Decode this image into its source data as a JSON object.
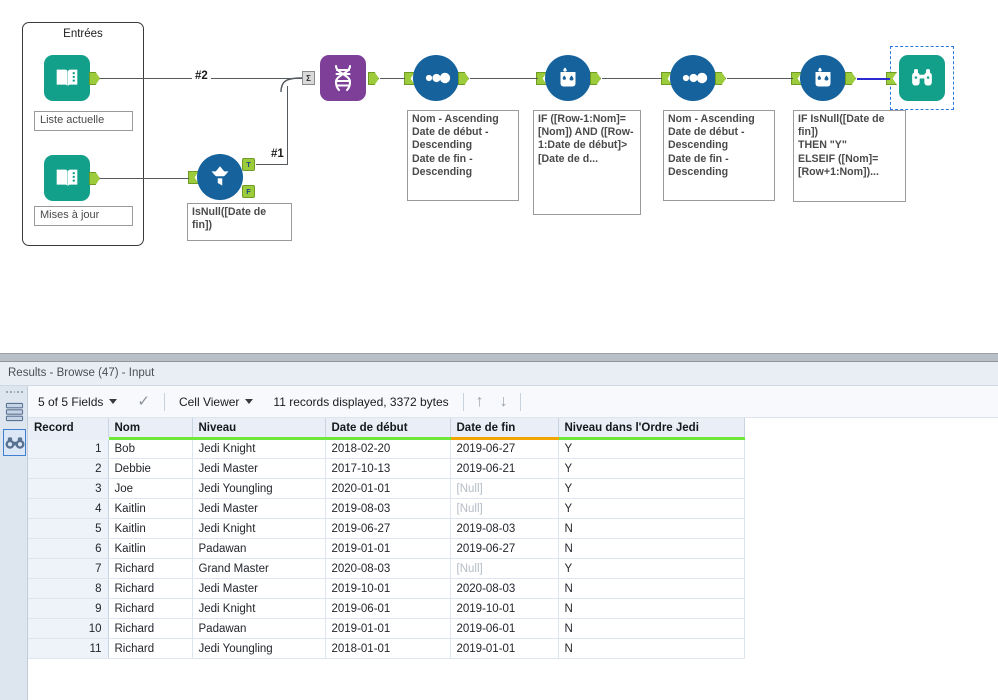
{
  "canvas": {
    "container": {
      "title": "Entrées"
    },
    "wire_labels": {
      "w2": "#2",
      "w1": "#1"
    },
    "tools": [
      {
        "id": "liste-actuelle",
        "type": "text-input",
        "icon": "book-icon",
        "label": "Liste actuelle"
      },
      {
        "id": "mises-a-jour",
        "type": "text-input",
        "icon": "book-icon",
        "label": "Mises à jour"
      },
      {
        "id": "filter",
        "type": "filter",
        "icon": "funnel-icon",
        "label": "IsNull([Date de fin])",
        "true_anchor": "T",
        "false_anchor": "F"
      },
      {
        "id": "union",
        "type": "union",
        "icon": "dna-icon",
        "label": "",
        "multi_anchor": "Σ"
      },
      {
        "id": "sort-1",
        "type": "sort",
        "icon": "three-dots-icon",
        "label": "Nom - Ascending\nDate de début - Descending\nDate de fin - Descending"
      },
      {
        "id": "multi-row-formula-1",
        "type": "multi-row-formula",
        "icon": "beaker-icon",
        "label": "IF ([Row-1:Nom]=[Nom]) AND ([Row-1:Date de début]>[Date de d..."
      },
      {
        "id": "sort-2",
        "type": "sort",
        "icon": "three-dots-icon",
        "label": "Nom - Ascending\nDate de début - Descending\nDate de fin - Descending"
      },
      {
        "id": "multi-row-formula-2",
        "type": "multi-row-formula",
        "icon": "beaker-icon",
        "label": "IF IsNull([Date de fin])\nTHEN \"Y\"\nELSEIF ([Nom]=[Row+1:Nom])..."
      },
      {
        "id": "browse",
        "type": "browse",
        "icon": "binoculars-icon",
        "label": "",
        "selected": true
      }
    ]
  },
  "results": {
    "title": "Results - Browse (47) - Input",
    "rail": [
      {
        "name": "rows-icon",
        "selected": false
      },
      {
        "name": "binoculars-icon",
        "selected": true
      }
    ],
    "toolbar": {
      "fields": "5 of 5 Fields",
      "check": "✓",
      "viewer": "Cell Viewer",
      "records": "11 records displayed, 3372 bytes",
      "up_arrow": "↑",
      "down_arrow": "↓"
    },
    "table": {
      "columns": [
        {
          "label": "Record",
          "underline": "none"
        },
        {
          "label": "Nom",
          "underline": "green"
        },
        {
          "label": "Niveau",
          "underline": "green"
        },
        {
          "label": "Date de début",
          "underline": "green"
        },
        {
          "label": "Date de fin",
          "underline": "orange"
        },
        {
          "label": "Niveau dans l'Ordre Jedi",
          "underline": "green"
        }
      ],
      "null_text": "[Null]",
      "rows": [
        {
          "record": "1",
          "nom": "Bob",
          "niveau": "Jedi Knight",
          "debut": "2018-02-20",
          "fin": "2019-06-27",
          "ordre": "Y"
        },
        {
          "record": "2",
          "nom": "Debbie",
          "niveau": "Jedi Master",
          "debut": "2017-10-13",
          "fin": "2019-06-21",
          "ordre": "Y"
        },
        {
          "record": "3",
          "nom": "Joe",
          "niveau": "Jedi Youngling",
          "debut": "2020-01-01",
          "fin": "[Null]",
          "ordre": "Y"
        },
        {
          "record": "4",
          "nom": "Kaitlin",
          "niveau": "Jedi Master",
          "debut": "2019-08-03",
          "fin": "[Null]",
          "ordre": "Y"
        },
        {
          "record": "5",
          "nom": "Kaitlin",
          "niveau": "Jedi Knight",
          "debut": "2019-06-27",
          "fin": "2019-08-03",
          "ordre": "N"
        },
        {
          "record": "6",
          "nom": "Kaitlin",
          "niveau": "Padawan",
          "debut": "2019-01-01",
          "fin": "2019-06-27",
          "ordre": "N"
        },
        {
          "record": "7",
          "nom": "Richard",
          "niveau": "Grand Master",
          "debut": "2020-08-03",
          "fin": "[Null]",
          "ordre": "Y"
        },
        {
          "record": "8",
          "nom": "Richard",
          "niveau": "Jedi Master",
          "debut": "2019-10-01",
          "fin": "2020-08-03",
          "ordre": "N"
        },
        {
          "record": "9",
          "nom": "Richard",
          "niveau": "Jedi Knight",
          "debut": "2019-06-01",
          "fin": "2019-10-01",
          "ordre": "N"
        },
        {
          "record": "10",
          "nom": "Richard",
          "niveau": "Padawan",
          "debut": "2019-01-01",
          "fin": "2019-06-01",
          "ordre": "N"
        },
        {
          "record": "11",
          "nom": "Richard",
          "niveau": "Jedi Youngling",
          "debut": "2018-01-01",
          "fin": "2019-01-01",
          "ordre": "N"
        }
      ]
    }
  },
  "colors": {
    "teal": "#12a08a",
    "blue": "#15629c",
    "purple": "#7d3f98",
    "anchor_green": "#9ccb3b",
    "header_green": "#6ee83b",
    "header_orange": "#f0a500",
    "selection_blue": "#2a7ade"
  }
}
